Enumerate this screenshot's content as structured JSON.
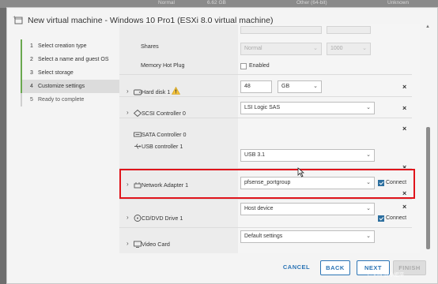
{
  "background": {
    "col1": "Normal",
    "col2": "6.62 GB",
    "col3": "Other (64-bit)",
    "col4": "Unknown"
  },
  "modal": {
    "title": "New virtual machine - Windows 10 Pro1 (ESXi 8.0 virtual machine)"
  },
  "steps": [
    {
      "num": "1",
      "label": "Select creation type",
      "state": "done"
    },
    {
      "num": "2",
      "label": "Select a name and guest OS",
      "state": "done"
    },
    {
      "num": "3",
      "label": "Select storage",
      "state": "done"
    },
    {
      "num": "4",
      "label": "Customize settings",
      "state": "active"
    },
    {
      "num": "5",
      "label": "Ready to complete",
      "state": "pending"
    }
  ],
  "settings": {
    "shares": {
      "label": "Shares",
      "level": "Normal",
      "value": "1000"
    },
    "memory_hot_plug": {
      "label": "Memory Hot Plug",
      "checkbox_label": "Enabled",
      "checked": false
    },
    "hard_disk": {
      "label": "Hard disk 1",
      "size": "48",
      "unit": "GB"
    },
    "scsi": {
      "label": "SCSI Controller 0",
      "type": "LSI Logic SAS"
    },
    "sata": {
      "label": "SATA Controller 0"
    },
    "usb": {
      "label": "USB controller 1",
      "type": "USB 3.1"
    },
    "network": {
      "label": "Network Adapter 1",
      "portgroup": "pfsense_portgroup",
      "connect_label": "Connect",
      "connected": true
    },
    "cdrom": {
      "label": "CD/DVD Drive 1",
      "type": "Host device",
      "connect_label": "Connect",
      "connected": true
    },
    "video": {
      "label": "Video Card",
      "type": "Default settings"
    }
  },
  "footer": {
    "cancel": "CANCEL",
    "back": "BACK",
    "next": "NEXT",
    "finish": "FINISH"
  },
  "watermark": "CSDN @小细平",
  "colors": {
    "accent": "#2b74b5",
    "step_done": "#6aa84f",
    "highlight": "#e0141b",
    "checkbox_on": "#2d6f9f"
  }
}
